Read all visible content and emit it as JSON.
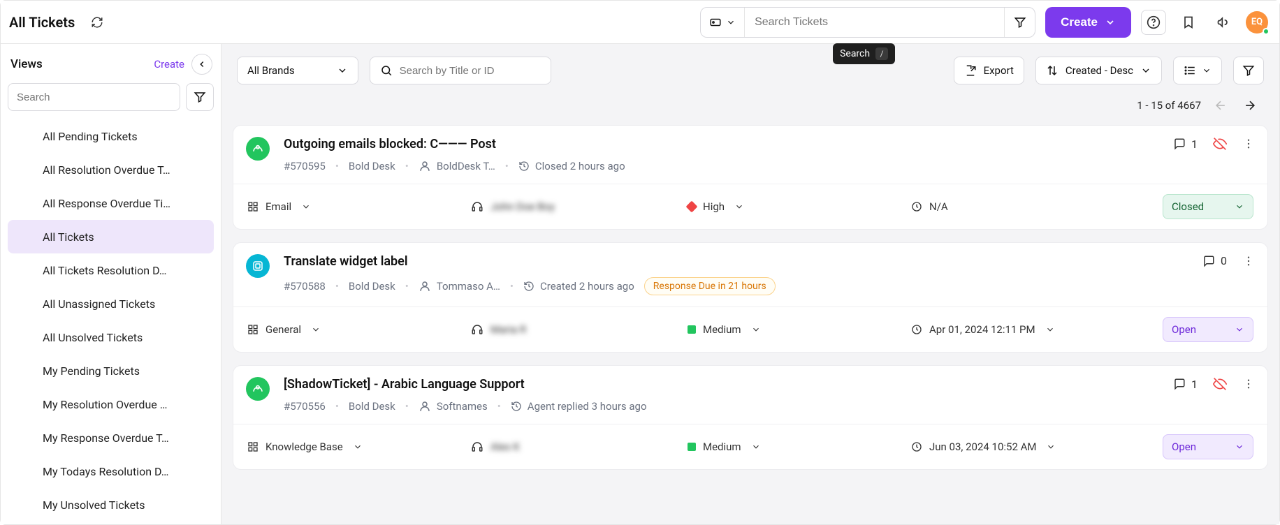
{
  "header": {
    "title": "All Tickets",
    "search_placeholder": "Search Tickets",
    "create_label": "Create",
    "avatar_initials": "EQ"
  },
  "tooltip": {
    "text": "Search",
    "key": "/"
  },
  "sidebar": {
    "title": "Views",
    "create_label": "Create",
    "search_placeholder": "Search",
    "items": [
      "All Pending Tickets",
      "All Resolution Overdue T…",
      "All Response Overdue Ti…",
      "All Tickets",
      "All Tickets Resolution D…",
      "All Unassigned Tickets",
      "All Unsolved Tickets",
      "My Pending Tickets",
      "My Resolution Overdue …",
      "My Response Overdue T…",
      "My Todays Resolution D…",
      "My Unsolved Tickets"
    ],
    "active_index": 3
  },
  "toolbar": {
    "brand": "All Brands",
    "search_placeholder": "Search by Title or ID",
    "export": "Export",
    "sort": "Created - Desc"
  },
  "pagination": {
    "text": "1 - 15 of 4667"
  },
  "tickets": [
    {
      "source_color": "green",
      "source_kind": "api",
      "title": "Outgoing emails blocked: C——— Post",
      "id": "#570595",
      "brand": "Bold Desk",
      "requester": "BoldDesk T…",
      "activity": "Closed 2 hours ago",
      "comment_count": "1",
      "hidden": true,
      "category": "Email",
      "agent": "John Doe Boy",
      "priority_label": "High",
      "priority_level": "high",
      "date": "N/A",
      "status": "Closed",
      "status_kind": "closed",
      "response_due": null
    },
    {
      "source_color": "teal",
      "source_kind": "widget",
      "title": "Translate widget label",
      "id": "#570588",
      "brand": "Bold Desk",
      "requester": "Tommaso A…",
      "activity": "Created 2 hours ago",
      "comment_count": "0",
      "hidden": false,
      "category": "General",
      "agent": "Maria R",
      "priority_label": "Medium",
      "priority_level": "medium",
      "date": "Apr 01, 2024 12:11 PM",
      "status": "Open",
      "status_kind": "open",
      "response_due": "Response Due in 21 hours"
    },
    {
      "source_color": "green",
      "source_kind": "api",
      "title": "[ShadowTicket] - Arabic Language Support",
      "id": "#570556",
      "brand": "Bold Desk",
      "requester": "Softnames",
      "activity": "Agent replied 3 hours ago",
      "comment_count": "1",
      "hidden": true,
      "category": "Knowledge Base",
      "agent": "Alex K",
      "priority_label": "Medium",
      "priority_level": "medium",
      "date": "Jun 03, 2024 10:52 AM",
      "status": "Open",
      "status_kind": "open",
      "response_due": null
    }
  ]
}
